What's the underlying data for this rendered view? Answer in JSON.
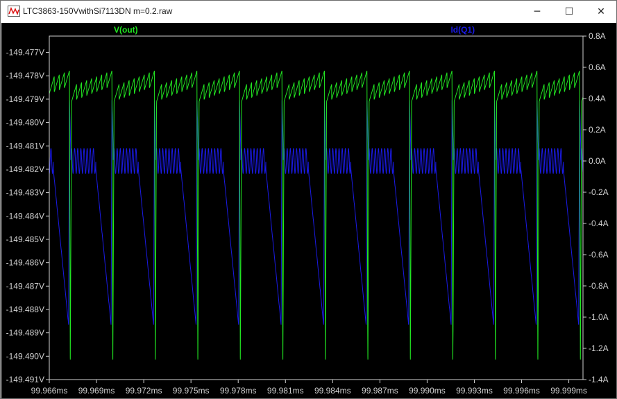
{
  "window": {
    "title": "LTC3863-150VwithSi7113DN m=0.2.raw",
    "app_icon": "waveform-icon",
    "minimize_icon": "minimize-icon",
    "maximize_icon": "maximize-icon",
    "close_icon": "close-icon",
    "minimize_glyph": "─",
    "maximize_glyph": "☐",
    "close_glyph": "✕"
  },
  "colors": {
    "background": "#000000",
    "axis": "#d0d0d0",
    "vout": "#22e822",
    "id": "#1a1ae6"
  },
  "chart_data": {
    "type": "line",
    "title": "",
    "grid": false,
    "legend": "top",
    "x_unit": "ms",
    "xlim": [
      99.966,
      99.9999
    ],
    "x_ticks": [
      "99.966ms",
      "99.969ms",
      "99.972ms",
      "99.975ms",
      "99.978ms",
      "99.981ms",
      "99.984ms",
      "99.987ms",
      "99.990ms",
      "99.993ms",
      "99.996ms",
      "99.999ms"
    ],
    "left_axis": {
      "label": "V(out)",
      "unit": "V",
      "range": [
        -149.491,
        -149.4763
      ],
      "ticks": [
        "-149.477V",
        "-149.478V",
        "-149.479V",
        "-149.480V",
        "-149.481V",
        "-149.482V",
        "-149.483V",
        "-149.484V",
        "-149.485V",
        "-149.486V",
        "-149.487V",
        "-149.488V",
        "-149.489V",
        "-149.490V",
        "-149.491V"
      ]
    },
    "right_axis": {
      "label": "Id(Q1)",
      "unit": "A",
      "range": [
        -1.4,
        0.8
      ],
      "ticks": [
        "0.8A",
        "0.6A",
        "0.4A",
        "0.2A",
        "0.0A",
        "-0.2A",
        "-0.4A",
        "-0.6A",
        "-0.8A",
        "-1.0A",
        "-1.2A",
        "-1.4A"
      ]
    },
    "switching_period_ms": 0.0027,
    "first_drop_ms": 99.96728,
    "series": [
      {
        "name": "V(out)",
        "axis": "left",
        "ripple_low_V": -149.4791,
        "ripple_high_V": -149.4779,
        "ripple_cycles_per_period": 8,
        "drop_min_V": -149.4905,
        "recovery_V": -149.4791
      },
      {
        "name": "Id(Q1)",
        "axis": "right",
        "ripple_high_A": 0.08,
        "ripple_low_A": -0.08,
        "ripple_cycles_per_period": 8,
        "spike_A": 0.4,
        "min_A": -1.05
      }
    ]
  }
}
